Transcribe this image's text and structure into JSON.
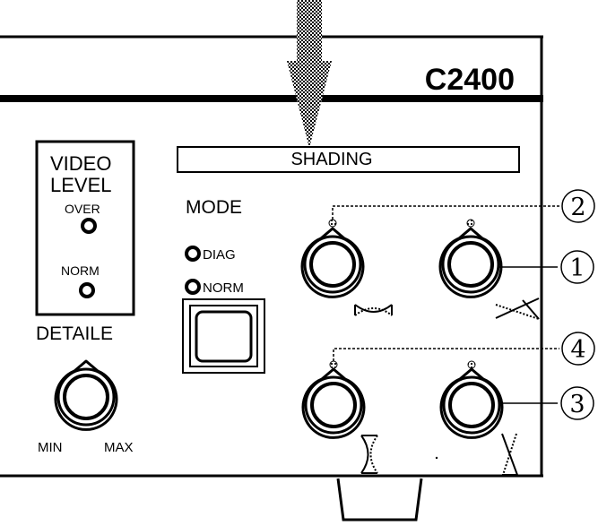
{
  "panel": {
    "model": "C2400",
    "shading_label": "SHADING"
  },
  "video_level": {
    "title_line1": "VIDEO",
    "title_line2": "LEVEL",
    "over_label": "OVER",
    "norm_label": "NORM"
  },
  "detaile": {
    "label": "DETAILE",
    "min_label": "MIN",
    "max_label": "MAX"
  },
  "mode": {
    "label": "MODE",
    "diag_label": "DIAG",
    "norm_label": "NORM"
  },
  "callouts": {
    "one": "1",
    "two": "2",
    "three": "3",
    "four": "4"
  },
  "colors": {
    "ink": "#000000",
    "background": "#ffffff",
    "arrow_stipple": "#555555"
  },
  "icons": {
    "arrow": "down-arrow-icon",
    "knob": "rotary-knob-icon",
    "led": "indicator-led-icon"
  }
}
